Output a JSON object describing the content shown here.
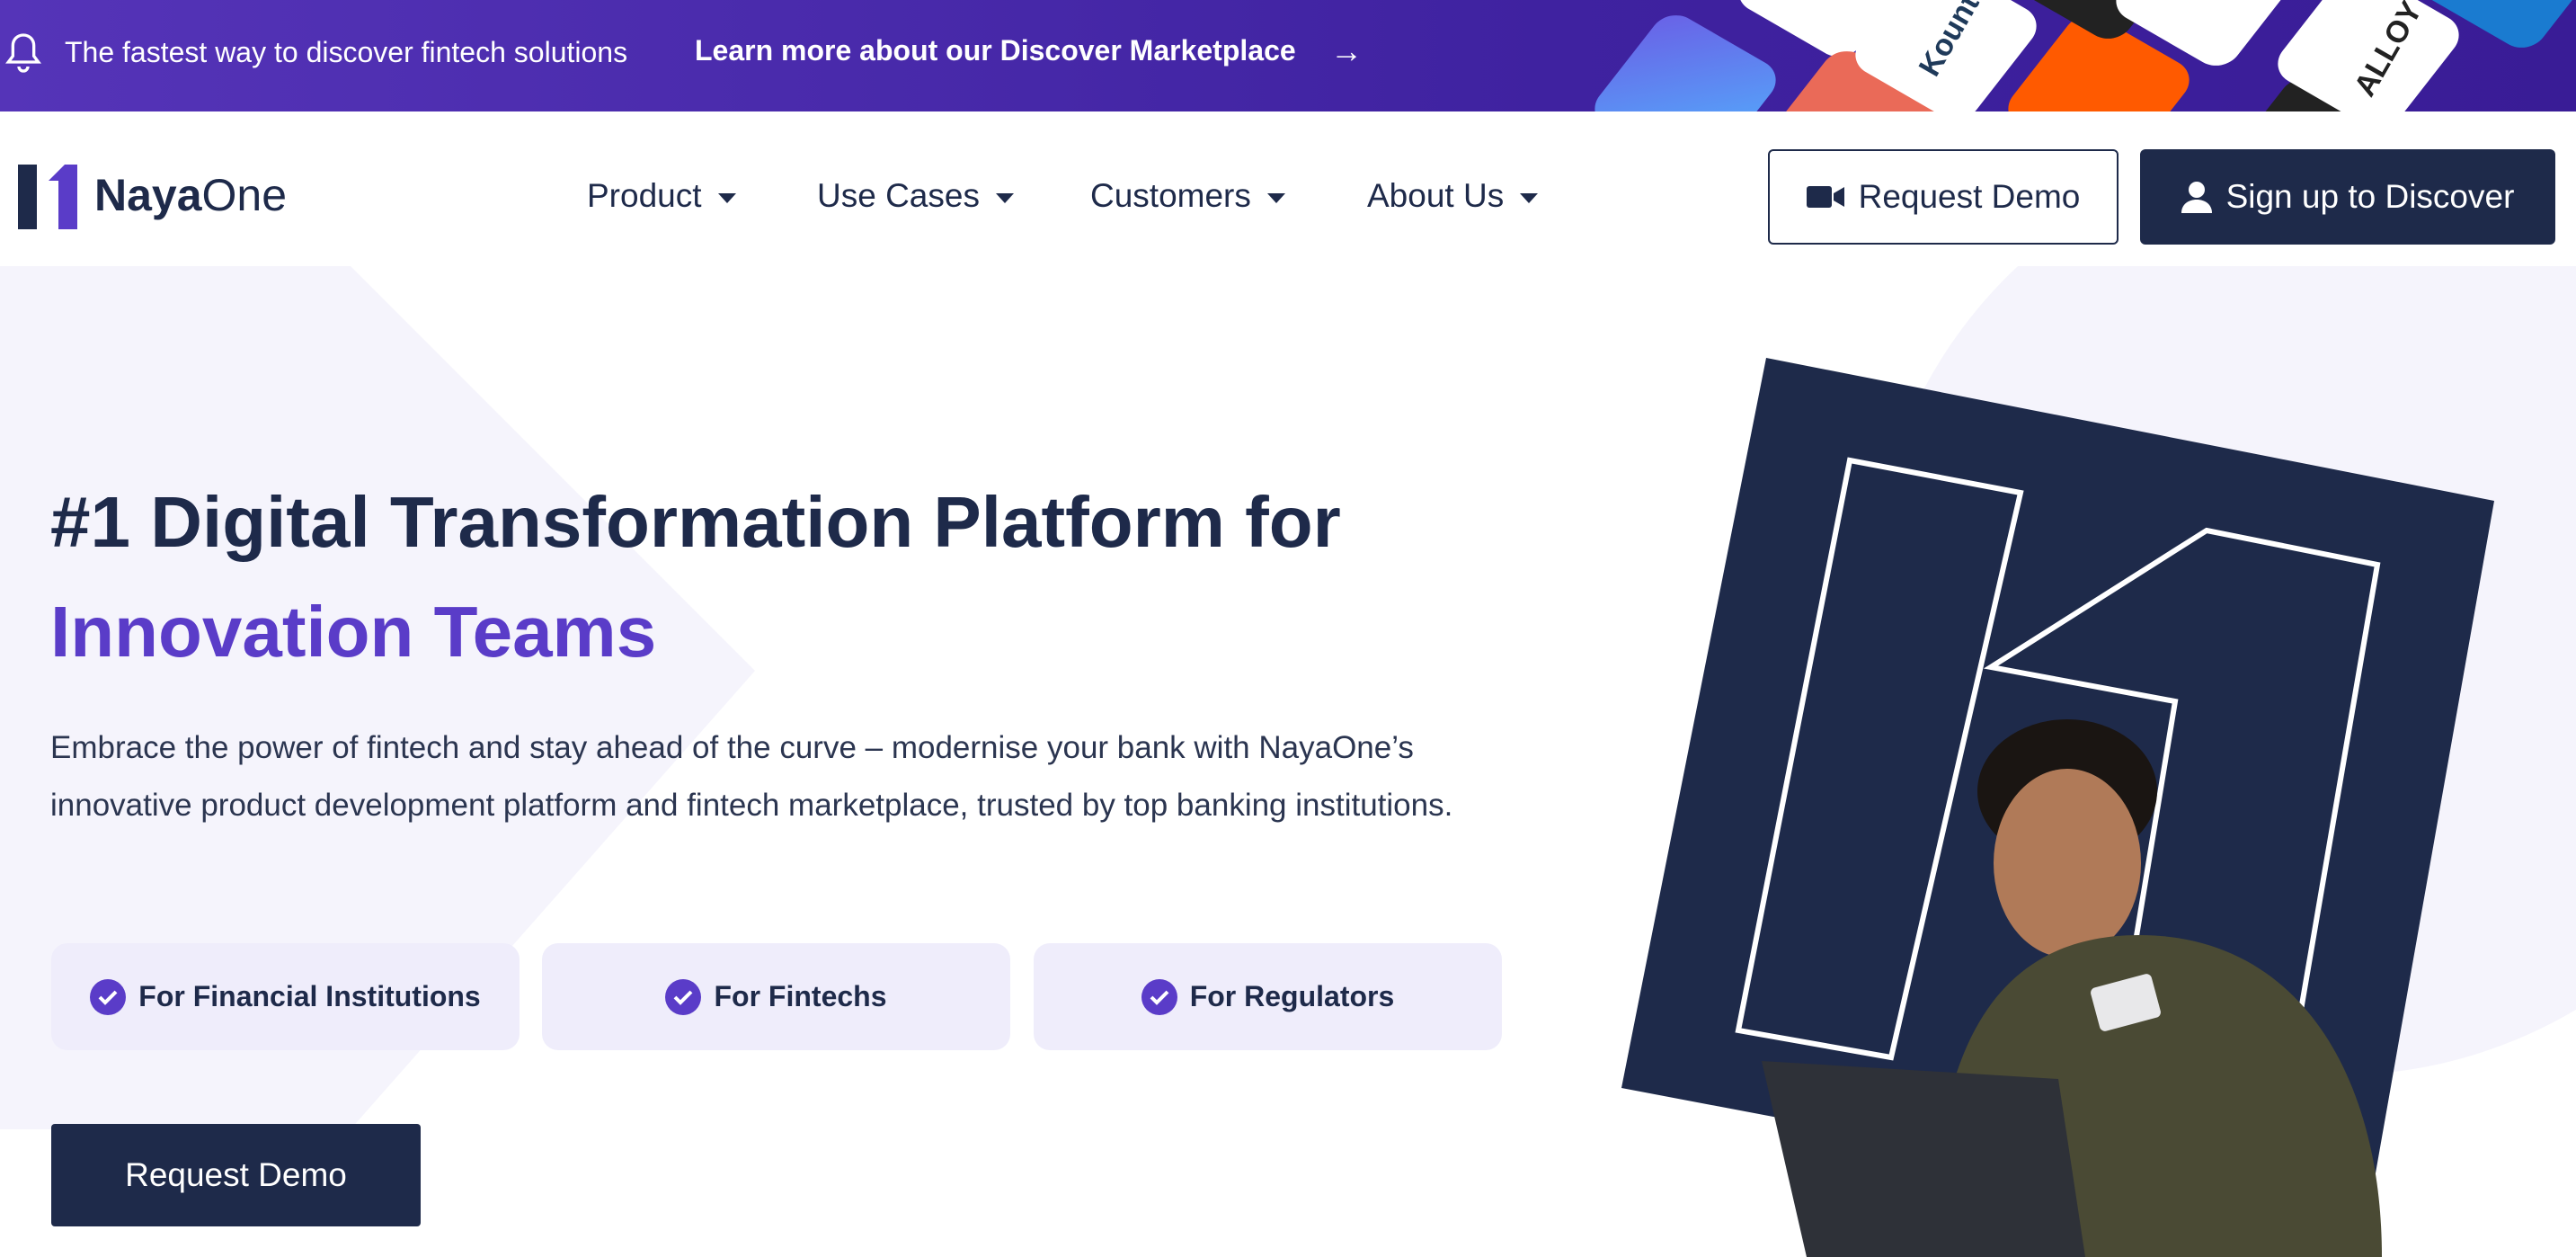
{
  "banner": {
    "message": "The fastest way to discover fintech solutions",
    "link": "Learn more about our Discover Marketplace",
    "icon": "bell-icon",
    "logos": [
      "Kount",
      "ALLOY"
    ]
  },
  "nav": {
    "brand_bold": "Naya",
    "brand_regular": "One",
    "items": [
      {
        "label": "Product"
      },
      {
        "label": "Use Cases"
      },
      {
        "label": "Customers"
      },
      {
        "label": "About Us"
      }
    ],
    "request_demo": "Request Demo",
    "sign_up": "Sign up to Discover"
  },
  "hero": {
    "title_line1": "#1 Digital Transformation Platform for",
    "title_line2": "Innovation Teams",
    "description": "Embrace the power of fintech and stay ahead of the curve – modernise your bank with NayaOne’s innovative product development platform and fintech marketplace, trusted by top banking institutions.",
    "pills": [
      {
        "label": "For Financial Institutions"
      },
      {
        "label": "For Fintechs"
      },
      {
        "label": "For Regulators"
      }
    ],
    "cta": "Request Demo"
  },
  "colors": {
    "navy": "#1e2a4a",
    "accent": "#5a3cc8",
    "banner": "#4a2bb0",
    "pill": "#efedfb"
  }
}
